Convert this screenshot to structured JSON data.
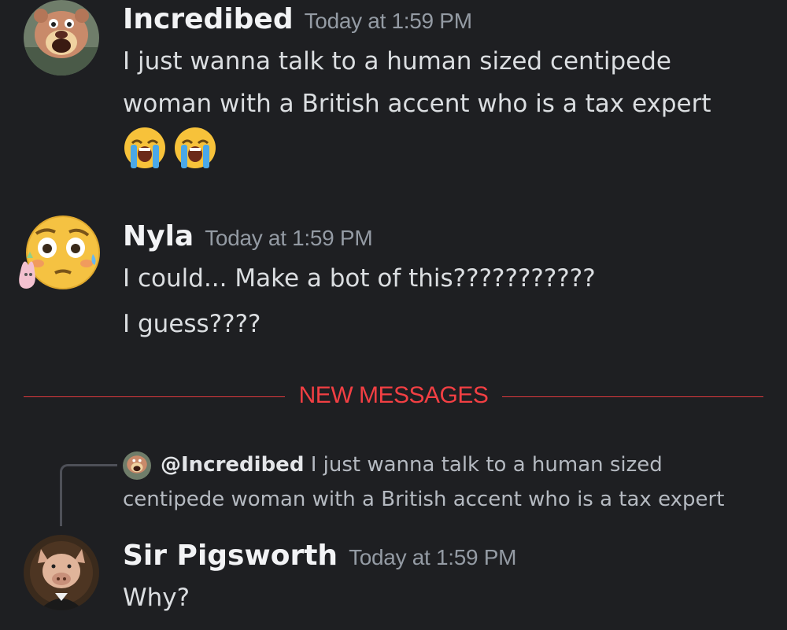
{
  "messages": [
    {
      "username": "Incredibed",
      "timestamp": "Today at 1:59 PM",
      "lines": [
        "I just wanna talk to a human sized centipede",
        "woman with a British accent who is a tax expert"
      ],
      "emojis": [
        "loudly-crying-face",
        "loudly-crying-face"
      ]
    },
    {
      "username": "Nyla",
      "timestamp": "Today at 1:59 PM",
      "lines": [
        "I could... Make a bot of this???????????",
        "I guess????"
      ]
    },
    {
      "reply": {
        "mention": "@Incredibed",
        "text_line1": "I just wanna talk to a human sized",
        "text_line2": "centipede woman with a British accent who is a tax expert"
      },
      "username": "Sir Pigsworth",
      "timestamp": "Today at 1:59 PM",
      "lines": [
        "Why?"
      ]
    }
  ],
  "divider": {
    "label": "NEW MESSAGES"
  },
  "colors": {
    "background": "#1e1f22",
    "new_messages": "#f23f43",
    "username": "#f2f3f5",
    "timestamp": "#949ba4"
  },
  "icons": {
    "avatar_incredibed": "bear-mascot-avatar",
    "avatar_nyla": "flushed-face-avatar",
    "avatar_sir_pigsworth": "pig-portrait-avatar"
  }
}
